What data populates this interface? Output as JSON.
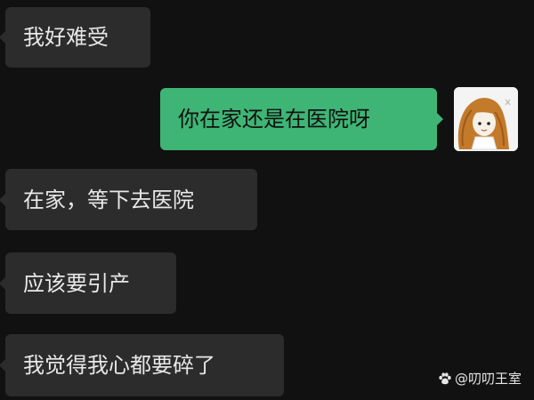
{
  "messages": [
    {
      "id": "m1",
      "side": "incoming",
      "text": "我好难受"
    },
    {
      "id": "m2",
      "side": "outgoing",
      "text": "你在家还是在医院呀"
    },
    {
      "id": "m3",
      "side": "incoming",
      "text": "在家，等下去医院"
    },
    {
      "id": "m4",
      "side": "incoming",
      "text": "应该要引产"
    },
    {
      "id": "m5",
      "side": "incoming",
      "text": "我觉得我心都要碎了"
    }
  ],
  "watermark": {
    "icon": "paw-icon",
    "text": "@叨叨王室"
  },
  "colors": {
    "background": "#111111",
    "incoming_bubble": "#2c2c2c",
    "outgoing_bubble": "#3eb575",
    "incoming_text": "#e8e8e8",
    "outgoing_text": "#111111"
  },
  "avatar": {
    "icon": "avatar-icon",
    "description_hidden": true
  }
}
